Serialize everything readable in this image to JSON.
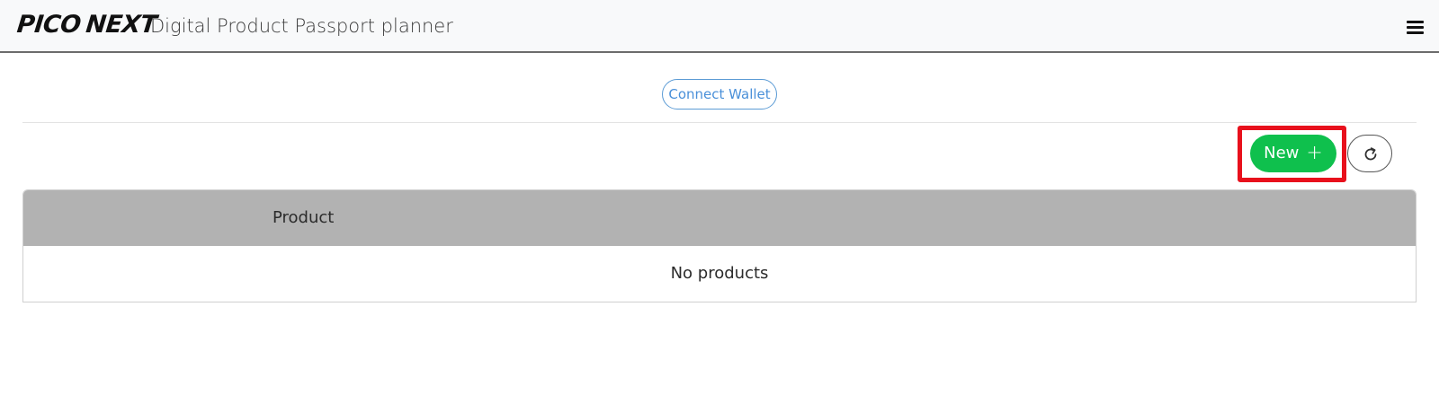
{
  "header": {
    "logo_left": "PICO",
    "logo_right": "NEXT",
    "title": "Digital Product Passport planner",
    "menu_icon": "hamburger-menu-icon"
  },
  "wallet": {
    "connect_label": "Connect Wallet"
  },
  "toolbar": {
    "new_label": "New",
    "new_icon": "plus-icon",
    "new_icon_glyph": "+",
    "refresh_icon": "refresh-icon",
    "highlight_color": "#e8101c",
    "new_button_color": "#0fc04d"
  },
  "table": {
    "columns": [
      "Product"
    ],
    "empty_message": "No products",
    "header_color": "#b2b2b2"
  }
}
